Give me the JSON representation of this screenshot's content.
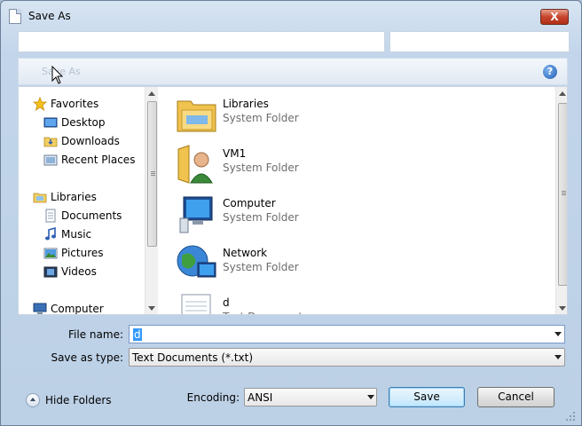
{
  "window": {
    "title": "Save As"
  },
  "toolbar": {
    "label": "Save As"
  },
  "navigation": {
    "favorites_label": "Favorites",
    "favorites": [
      {
        "label": "Desktop",
        "icon": "desktop-icon"
      },
      {
        "label": "Downloads",
        "icon": "downloads-folder-icon"
      },
      {
        "label": "Recent Places",
        "icon": "recent-places-icon"
      }
    ],
    "libraries_label": "Libraries",
    "libraries": [
      {
        "label": "Documents",
        "icon": "documents-icon"
      },
      {
        "label": "Music",
        "icon": "music-icon"
      },
      {
        "label": "Pictures",
        "icon": "pictures-icon"
      },
      {
        "label": "Videos",
        "icon": "videos-icon"
      }
    ],
    "computer_label": "Computer"
  },
  "files": [
    {
      "name": "Libraries",
      "type": "System Folder",
      "icon": "libraries-folder-icon"
    },
    {
      "name": "VM1",
      "type": "System Folder",
      "icon": "user-folder-icon"
    },
    {
      "name": "Computer",
      "type": "System Folder",
      "icon": "computer-icon"
    },
    {
      "name": "Network",
      "type": "System Folder",
      "icon": "network-icon"
    },
    {
      "name": "d",
      "type": "Text Document",
      "icon": "text-document-icon"
    }
  ],
  "form": {
    "file_name_label": "File name:",
    "file_name_value": "d",
    "save_as_type_label": "Save as type:",
    "save_as_type_value": "Text Documents (*.txt)",
    "encoding_label": "Encoding:",
    "encoding_value": "ANSI"
  },
  "buttons": {
    "hide_folders": "Hide Folders",
    "save": "Save",
    "cancel": "Cancel",
    "close": "X",
    "help": "?"
  },
  "colors": {
    "selection": "#3399ff",
    "close_button": "#c7452d",
    "window_frame": "#c2d5ea"
  }
}
